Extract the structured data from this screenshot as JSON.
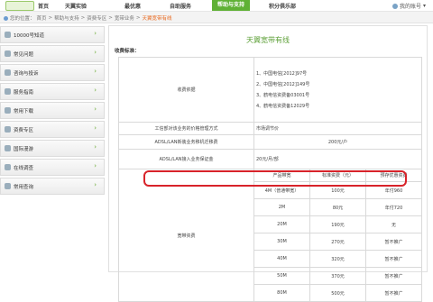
{
  "nav": {
    "items": [
      "首页",
      "天翼实验",
      "最优惠",
      "自助服务",
      "帮助与支持",
      "积分俱乐部"
    ],
    "active_index": 4,
    "account": "我的账号"
  },
  "breadcrumb": {
    "prefix": "您的位置：",
    "items": [
      "首页",
      "帮助与支持",
      "资费专区",
      "宽带业务"
    ],
    "current": "天翼宽带有线",
    "sep": ">"
  },
  "sidebar": {
    "items": [
      {
        "label": "10000号知道",
        "icon": "info-icon"
      },
      {
        "label": "常见问题",
        "icon": "question-icon"
      },
      {
        "label": "咨询与投诉",
        "icon": "chat-icon"
      },
      {
        "label": "服务指南",
        "icon": "guide-icon"
      },
      {
        "label": "常用下载",
        "icon": "download-icon"
      },
      {
        "label": "资费专区",
        "icon": "price-icon"
      },
      {
        "label": "国际漫游",
        "icon": "globe-icon"
      },
      {
        "label": "在线调查",
        "icon": "survey-icon"
      },
      {
        "label": "常用查询",
        "icon": "search-icon"
      }
    ]
  },
  "main": {
    "title": "天翼宽带有线",
    "subtitle": "收费标准：",
    "basis_label": "收费依据",
    "basis": [
      "1、中国电信[2012]97号",
      "2、中国电信[2012]149号",
      "3、鹤电信资费备03001号",
      "4、鹤电信资费备12029号"
    ],
    "rows": [
      {
        "label": "工信部对该业务的价格管理方式",
        "value": "市场调节价"
      },
      {
        "label": "ADSL/LAN新装业务移机迁移费",
        "value": "200元/户"
      },
      {
        "label": "ADSL/LAN接入业务保证金",
        "value": "20元/月/部"
      }
    ],
    "price": {
      "label": "宽带资费",
      "headers": [
        "产品带宽",
        "标准资费（元）",
        "预存优惠资费"
      ],
      "rows": [
        [
          "4M（普通带宽）",
          "100元",
          "年付960"
        ],
        [
          "2M",
          "80元",
          "年付720"
        ],
        [
          "20M",
          "190元",
          "无"
        ],
        [
          "30M",
          "270元",
          "暂不推广"
        ],
        [
          "40M",
          "320元",
          "暂不推广"
        ],
        [
          "50M",
          "370元",
          "暂不推广"
        ],
        [
          "80M",
          "500元",
          "暂不推广"
        ]
      ]
    }
  },
  "colors": {
    "accent": "#5fb135",
    "highlight": "#d8232a",
    "link": "#e8671c"
  }
}
